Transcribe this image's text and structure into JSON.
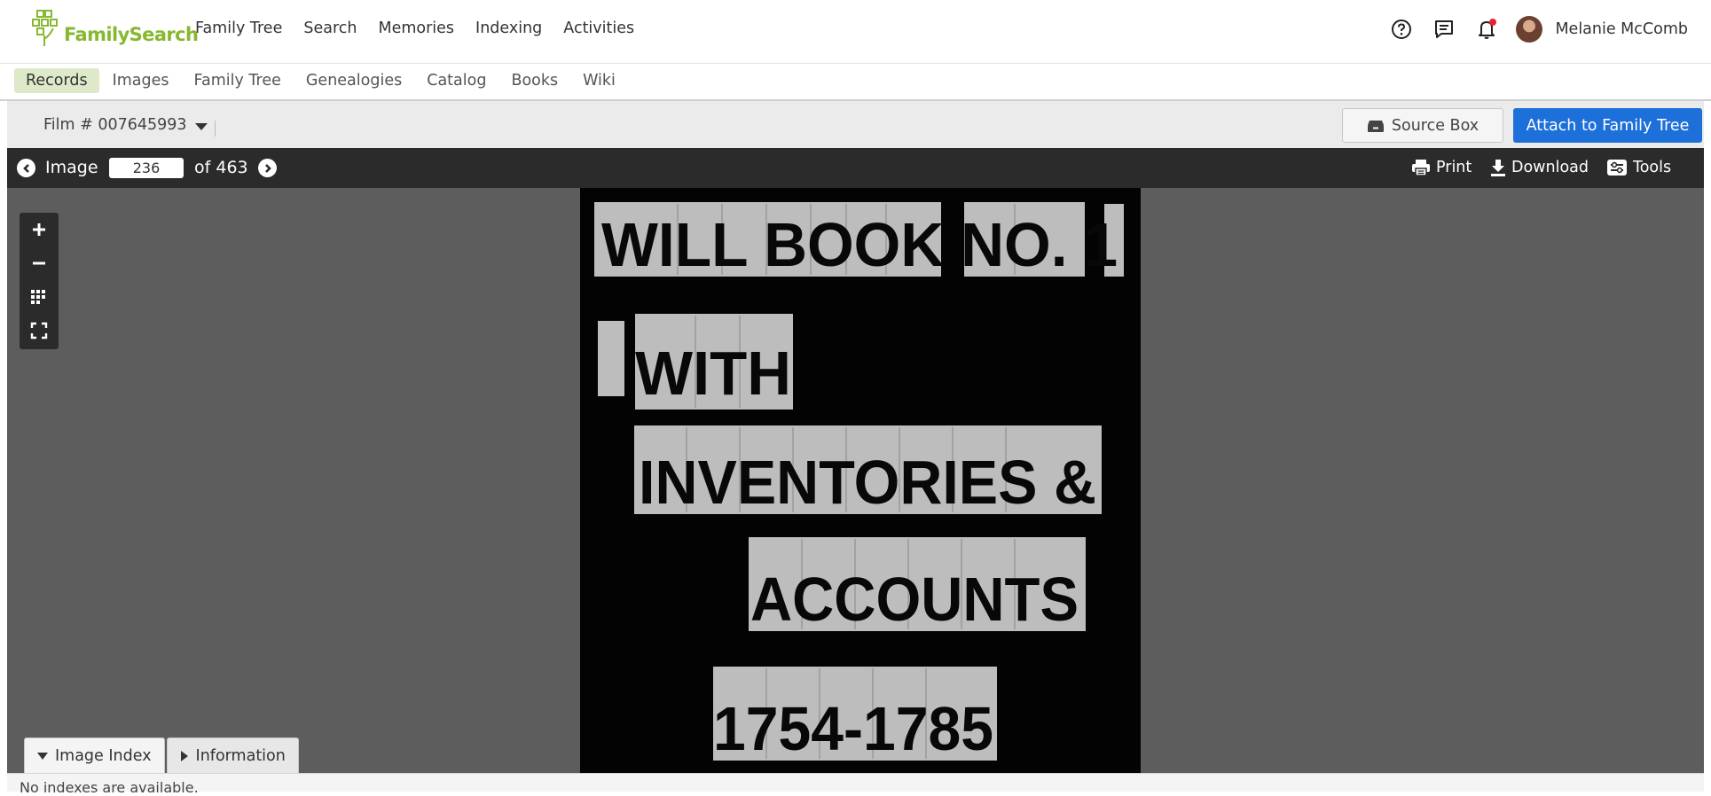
{
  "brand": {
    "name": "FamilySearch",
    "color": "#87b830"
  },
  "topnav": [
    "Family Tree",
    "Search",
    "Memories",
    "Indexing",
    "Activities"
  ],
  "user": {
    "name": "Melanie McComb"
  },
  "icons": {
    "help": "help-icon",
    "messages": "messages-icon",
    "notifications": "bell-icon"
  },
  "subnav": {
    "active": "Records",
    "items": [
      "Records",
      "Images",
      "Family Tree",
      "Genealogies",
      "Catalog",
      "Books",
      "Wiki"
    ]
  },
  "film": {
    "label": "Film # 007645993"
  },
  "actions": {
    "source_box": "Source Box",
    "attach": "Attach to Family Tree",
    "accent": "#1d6fd9"
  },
  "image_nav": {
    "label": "Image",
    "current": "236",
    "of_total": "of 463"
  },
  "tools": {
    "print": "Print",
    "download": "Download",
    "tools": "Tools"
  },
  "document": {
    "lines": [
      "WILL BOOK NO. 1",
      "WITH",
      "INVENTORIES &",
      "ACCOUNTS",
      "1754-1785"
    ]
  },
  "tabs": {
    "index": "Image Index",
    "info": "Information"
  },
  "index_message": "No indexes are available."
}
